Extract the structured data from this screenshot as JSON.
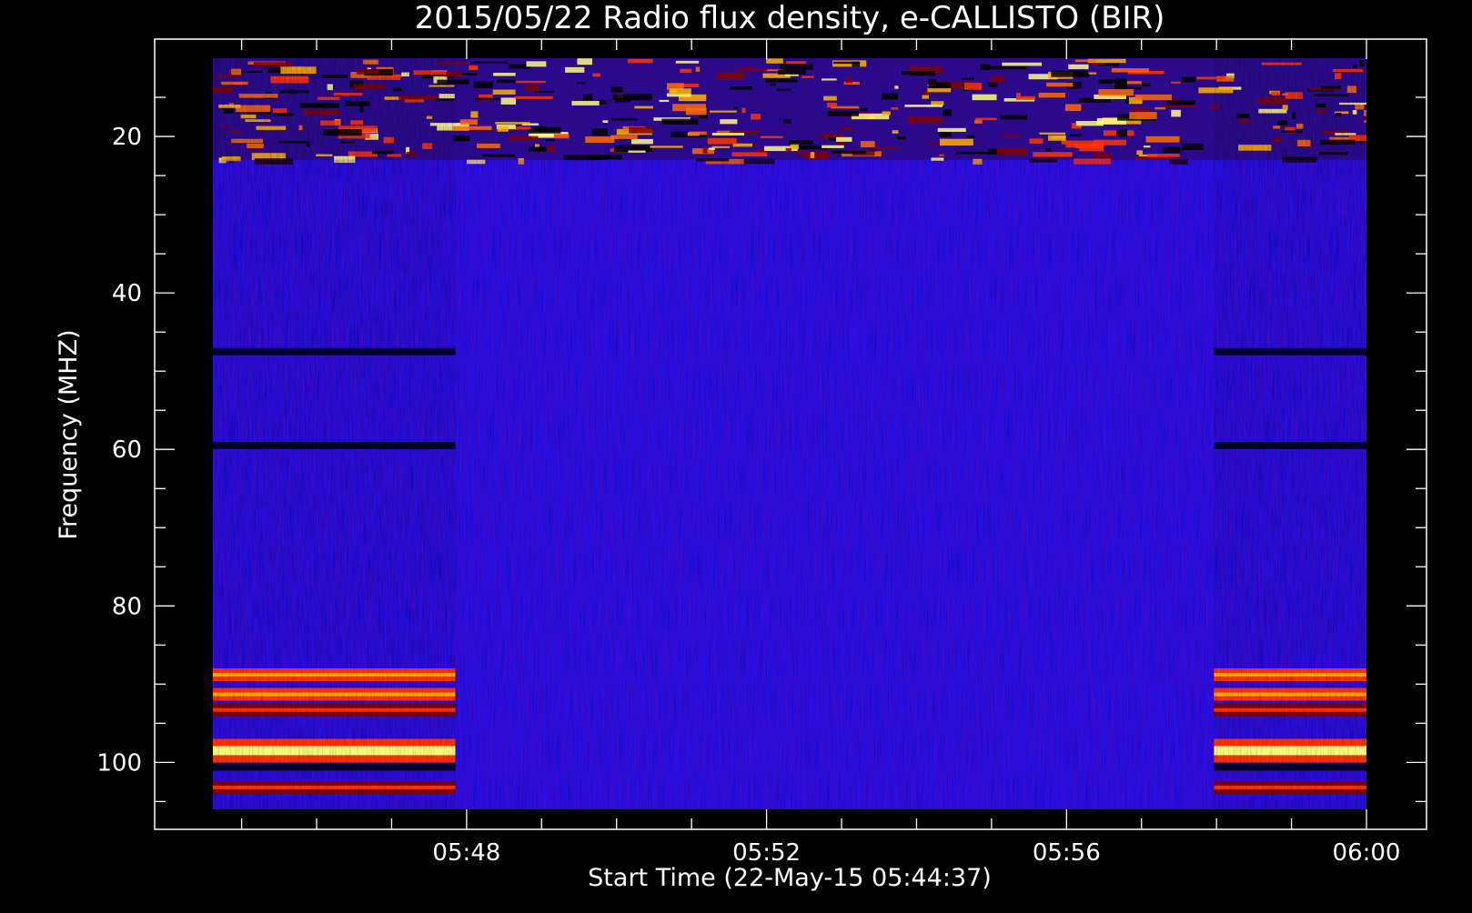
{
  "chart_data": {
    "type": "heatmap",
    "title": "2015/05/22  Radio flux density, e-CALLISTO (BIR)",
    "xlabel": "Start Time (22-May-15 05:44:37)",
    "ylabel": "Frequency (MHZ)",
    "x_start": "05:44:37",
    "x_end": "06:00:00",
    "xlim": [
      "05:44:37",
      "06:00:00"
    ],
    "ylim": [
      10,
      106
    ],
    "y_reversed": true,
    "x_ticks": [
      "05:48",
      "05:52",
      "05:56",
      "06:00"
    ],
    "y_ticks": [
      20,
      40,
      60,
      80,
      100
    ],
    "colormap": [
      "#000000",
      "#0000ff",
      "#800000",
      "#ff3300",
      "#ffb000",
      "#ffff80"
    ],
    "background_color": "#1a10f0",
    "grid": false,
    "legend": "none",
    "rfi_segments": [
      [
        "05:44:37",
        "05:47:51"
      ],
      [
        "05:57:58",
        "06:00:00"
      ]
    ],
    "emission_bands_mhz": [
      {
        "freq": 88.8,
        "level": "strong"
      },
      {
        "freq": 91.3,
        "level": "strong"
      },
      {
        "freq": 93.3,
        "level": "medium"
      },
      {
        "freq": 98.5,
        "level": "very strong"
      },
      {
        "freq": 103.2,
        "level": "medium"
      }
    ],
    "dark_bands_mhz": [
      47.5,
      59.5,
      100.6
    ],
    "interference_region_mhz": [
      10,
      23
    ]
  }
}
